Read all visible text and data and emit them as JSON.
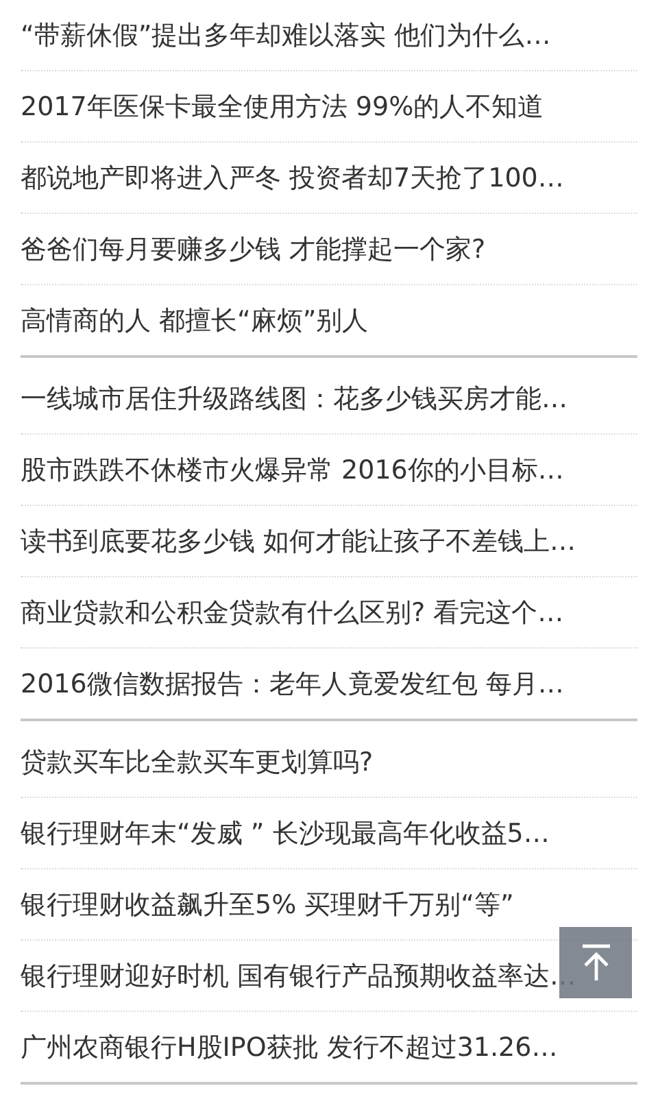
{
  "groups": [
    {
      "items": [
        "“带薪休假”提出多年却难以落实 他们为什么…",
        "2017年医保卡最全使用方法 99%的人不知道",
        "都说地产即将进入严冬 投资者却7天抢了100…",
        "爸爸们每月要赚多少钱 才能撑起一个家?",
        "高情商的人 都擅长“麻烦”别人"
      ]
    },
    {
      "items": [
        "一线城市居住升级路线图：花多少钱买房才能…",
        "股市跌跌不休楼市火爆异常 2016你的小目标…",
        "读书到底要花多少钱 如何才能让孩子不差钱上…",
        "商业贷款和公积金贷款有什么区别? 看完这个…",
        "2016微信数据报告：老年人竟爱发红包 每月…"
      ]
    },
    {
      "items": [
        "贷款买车比全款买车更划算吗?",
        "银行理财年末“发威 ” 长沙现最高年化收益5…",
        "银行理财收益飙升至5% 买理财千万别“等”",
        "银行理财迎好时机 国有银行产品预期收益率达…",
        "广州农商银行H股IPO获批 发行不超过31.26…"
      ]
    }
  ]
}
